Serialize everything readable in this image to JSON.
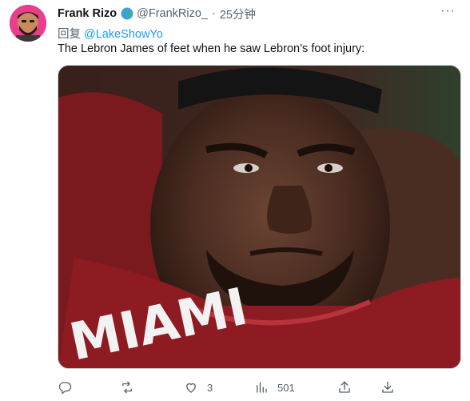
{
  "tweet": {
    "author_name": "Frank Rizo",
    "handle": "@FrankRizo_",
    "separator": "·",
    "timestamp": "25分钟",
    "more_label": "···",
    "reply_prefix": "回复",
    "reply_mention": "@LakeShowYo",
    "text": "The Lebron James of feet when he saw Lebron’s foot injury:",
    "image_text": "MIAMI"
  },
  "actions": {
    "reply_count": "",
    "retweet_count": "",
    "like_count": "3",
    "view_count": "501"
  },
  "colors": {
    "accent": "#1d9bf0",
    "secondary_text": "#536471",
    "jersey_red": "#8e1b22",
    "avatar_bg": "#e83e8c"
  },
  "icons": [
    "avatar",
    "globe-icon",
    "more-icon",
    "reply-icon",
    "retweet-icon",
    "like-icon",
    "views-icon",
    "share-icon",
    "download-icon"
  ]
}
